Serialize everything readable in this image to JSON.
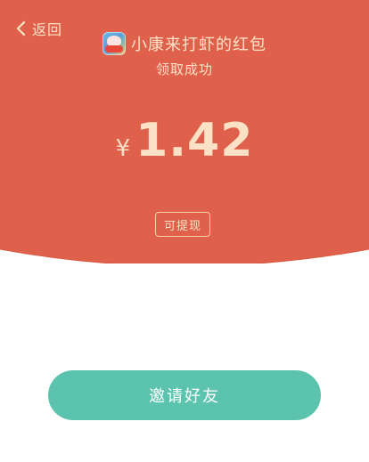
{
  "colors": {
    "background_red": "#e0614b",
    "text_cream": "#fbe2c7",
    "button_teal": "#5cc3ae",
    "button_text": "#ffffff",
    "page_background": "#ffffff"
  },
  "nav": {
    "back_label": "返回",
    "back_icon": "chevron-left-icon"
  },
  "header": {
    "app_icon": "app-logo-icon",
    "title": "小康来打虾的红包",
    "subtitle": "领取成功"
  },
  "amount": {
    "currency": "¥",
    "value": "1.42"
  },
  "withdraw_tag": {
    "label": "可提现"
  },
  "invite_button": {
    "label": "邀请好友"
  }
}
